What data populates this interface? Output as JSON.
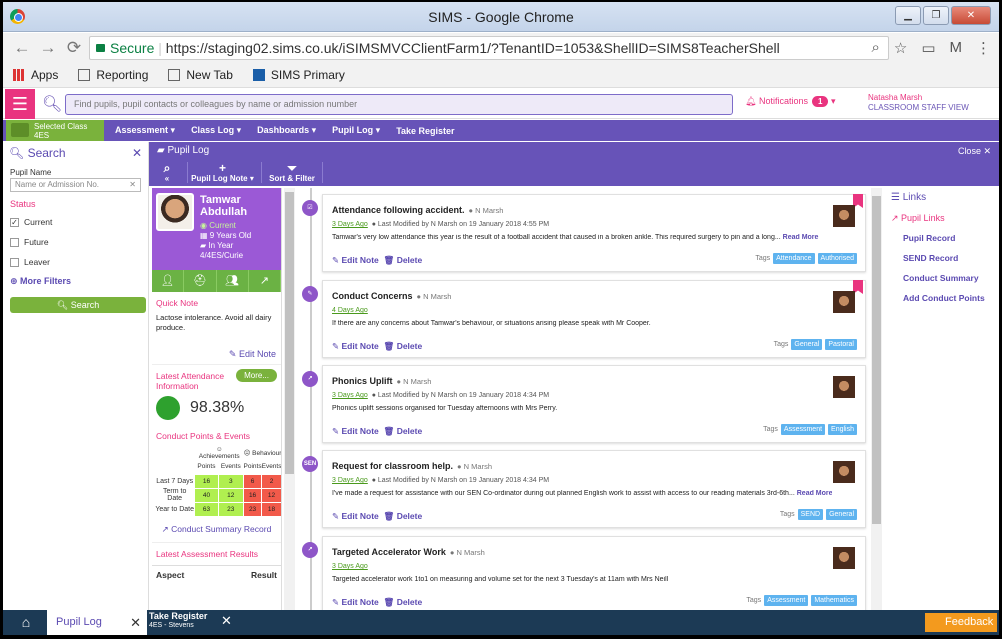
{
  "window": {
    "title": "SIMS - Google Chrome"
  },
  "browser": {
    "secure": "Secure",
    "url": "https://staging02.sims.co.uk/iSIMSMVCClientFarm1/?TenantID=1053&ShellID=SIMS8TeacherShell",
    "bookmarks": [
      "Apps",
      "Reporting",
      "New Tab",
      "SIMS Primary"
    ]
  },
  "top": {
    "search_placeholder": "Find pupils, pupil contacts or colleagues by name or admission number",
    "notifications": "Notifications",
    "notif_count": "1",
    "user_name": "Natasha Marsh",
    "user_role": "CLASSROOM STAFF VIEW"
  },
  "menubar": {
    "selected_label": "Selected Class",
    "selected_class": "4ES",
    "items": [
      "Assessment",
      "Class Log",
      "Dashboards",
      "Pupil Log",
      "Take Register"
    ]
  },
  "left": {
    "title": "Search",
    "pupil_name": "Pupil Name",
    "placeholder": "Name or Admission No.",
    "status": "Status",
    "options": [
      {
        "label": "Current",
        "checked": true
      },
      {
        "label": "Future",
        "checked": false
      },
      {
        "label": "Leaver",
        "checked": false
      }
    ],
    "more": "More Filters",
    "search_btn": "Search"
  },
  "panel": {
    "title": "Pupil Log",
    "close": "Close",
    "tools": [
      "Pupil Log Note",
      "Sort & Filter"
    ]
  },
  "pupil": {
    "first": "Tamwar",
    "last": "Abdullah",
    "status": "Current",
    "age": "9 Years Old",
    "year": "In Year",
    "class": "4/4ES/Curie",
    "quick_note_h": "Quick Note",
    "quick_note": "Lactose intolerance. Avoid all dairy produce.",
    "edit_note": "Edit Note",
    "att_h": "Latest Attendance Information",
    "more": "More...",
    "attendance": "98.38%",
    "conduct_h": "Conduct Points & Events",
    "ach": "Achievements",
    "beh": "Behaviour",
    "points": "Points",
    "events": "Events",
    "rows": [
      {
        "label": "Last 7 Days",
        "v": [
          "16",
          "3",
          "6",
          "2"
        ]
      },
      {
        "label": "Term to Date",
        "v": [
          "40",
          "12",
          "16",
          "12"
        ]
      },
      {
        "label": "Year to Date",
        "v": [
          "63",
          "23",
          "23",
          "18"
        ]
      }
    ],
    "csr": "Conduct Summary Record",
    "lar": "Latest Assessment Results",
    "aspect": "Aspect",
    "result": "Result"
  },
  "notes": [
    {
      "icon": "☑",
      "title": "Attendance following accident.",
      "by": "N Marsh",
      "ago": "3 Days Ago",
      "mod": "Last Modified by N Marsh on 19 January 2018 4:55 PM",
      "body": "Tamwar's very low attendance this year is the result of a football accident that caused in a broken ankle. This required surgery to pin and a long...",
      "rm": "Read More",
      "tags": [
        "Attendance",
        "Authorised"
      ],
      "pin": true
    },
    {
      "icon": "✎",
      "title": "Conduct Concerns",
      "by": "N Marsh",
      "ago": "4 Days Ago",
      "mod": "",
      "body": "If there are any concerns about Tamwar's behaviour, or situations arising please speak with Mr Cooper.",
      "rm": "",
      "tags": [
        "General",
        "Pastoral"
      ],
      "pin": true
    },
    {
      "icon": "↗",
      "title": "Phonics Uplift",
      "by": "N Marsh",
      "ago": "3 Days Ago",
      "mod": "Last Modified by N Marsh on 19 January 2018 4:34 PM",
      "body": "Phonics uplift sessions organised for Tuesday afternoons with Mrs Perry.",
      "rm": "",
      "tags": [
        "Assessment",
        "English"
      ],
      "pin": false
    },
    {
      "icon": "SEN",
      "title": "Request for classroom help.",
      "by": "N Marsh",
      "ago": "3 Days Ago",
      "mod": "Last Modified by N Marsh on 19 January 2018 4:34 PM",
      "body": "I've made a request for assistance with our SEN Co-ordinator during out planned English work to assist with access to our reading materials 3rd-6th...",
      "rm": "Read More",
      "tags": [
        "SEND",
        "General"
      ],
      "pin": false
    },
    {
      "icon": "↗",
      "title": "Targeted Accelerator Work",
      "by": "N Marsh",
      "ago": "3 Days Ago",
      "mod": "",
      "body": "Targeted accelerator work 1to1 on measuring and volume set for the next 3 Tuesday's at 11am with Mrs Neill",
      "rm": "",
      "tags": [
        "Assessment",
        "Mathematics"
      ],
      "pin": false
    }
  ],
  "note_actions": {
    "edit": "Edit Note",
    "delete": "Delete",
    "tags": "Tags"
  },
  "links": {
    "title": "Links",
    "pupil_links": "Pupil Links",
    "items": [
      "Pupil Record",
      "SEND Record",
      "Conduct Summary",
      "Add Conduct Points"
    ]
  },
  "taskbar": {
    "tab1": "Pupil Log",
    "tab2": "Take Register",
    "tab2_sub": "4ES - Stevens",
    "feedback": "Feedback"
  }
}
